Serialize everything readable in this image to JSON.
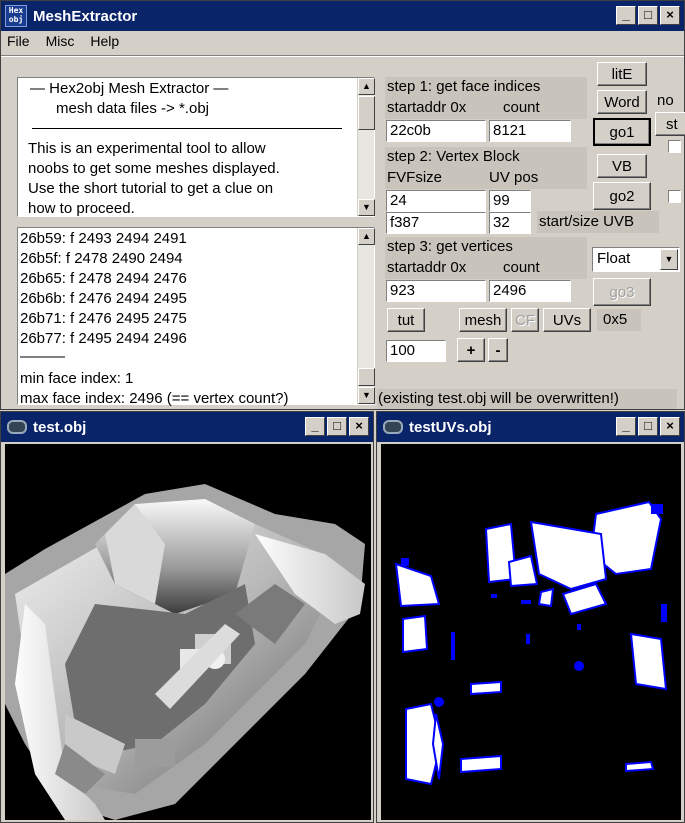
{
  "main_window": {
    "title": "MeshExtractor",
    "app_icon_text": "Hex obj",
    "menu": [
      "File",
      "Misc",
      "Help"
    ],
    "title_buttons": [
      "_",
      "□",
      "×"
    ]
  },
  "info_box": {
    "lines": [
      "—   Hex2obj Mesh Extractor   —",
      "mesh data files -> *.obj",
      "This is an experimental tool to allow",
      "noobs to get some meshes displayed.",
      "Use the short tutorial to get a clue on",
      "how to proceed."
    ]
  },
  "log_box": {
    "lines": [
      "26b59: f  2493 2494 2491",
      "26b5f: f  2478 2490 2494",
      "26b65: f  2478 2494 2476",
      "26b6b: f  2476 2494 2495",
      "26b71: f  2476 2495 2475",
      "26b77: f  2495 2494 2496",
      "———",
      "min face index: 1",
      "max face index: 2496 (== vertex count?)"
    ]
  },
  "step1": {
    "title": "step 1: get face indices",
    "addr_label": "startaddr 0x",
    "count_label": "count",
    "addr_value": "22c0b",
    "count_value": "8121"
  },
  "step2": {
    "title": "step 2: Vertex Block",
    "fvf_label": "FVFsize",
    "uvpos_label": "UV pos",
    "fvf_value": "24",
    "uvpos_value": "99",
    "uvb_start_value": "f387",
    "uvb_size_value": "32",
    "uvb_label": "start/size UVB"
  },
  "step3": {
    "title": "step 3: get vertices",
    "addr_label": "startaddr 0x",
    "count_label": "count",
    "addr_value": "923",
    "count_value": "2496",
    "type_select": "Float"
  },
  "buttons": {
    "lite": "litE",
    "word": "Word",
    "go1": "go1",
    "vb": "VB",
    "go2": "go2",
    "go3": "go3",
    "tut": "tut",
    "mesh": "mesh",
    "cf": "CF",
    "uvs": "UVs",
    "hex_label": "0x5",
    "plus": "+",
    "minus": "-",
    "side_top": "no",
    "side_mid": "st"
  },
  "zoom_value": "100",
  "status_text": "(existing test.obj will be overwritten!)",
  "test_window": {
    "title": "test.obj"
  },
  "uvs_window": {
    "title": "testUVs.obj"
  },
  "colors": {
    "titlebar": "#0a246a",
    "uv_blue": "#0000ff",
    "viewport_bg": "#000000"
  }
}
